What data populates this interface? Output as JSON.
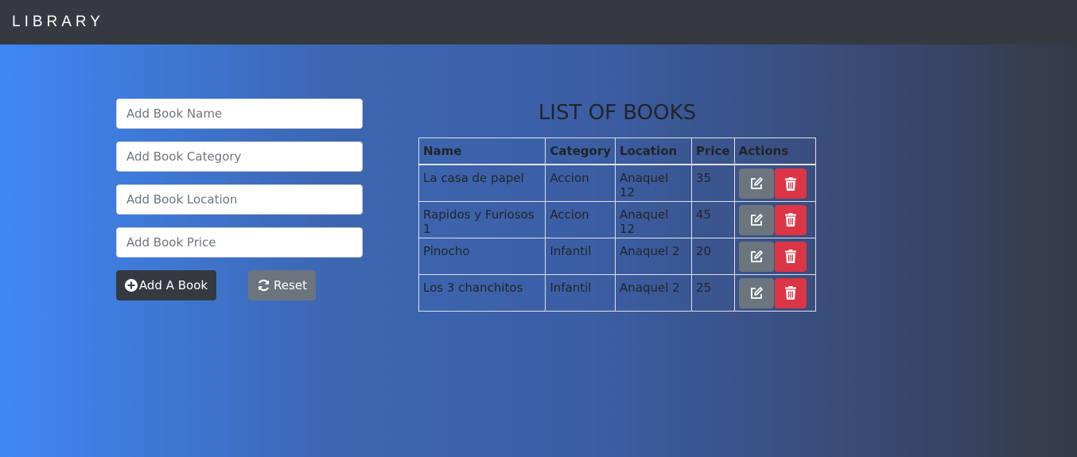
{
  "navbar": {
    "brand": "LIBRARY"
  },
  "form": {
    "name_placeholder": "Add Book Name",
    "category_placeholder": "Add Book Category",
    "location_placeholder": "Add Book Location",
    "price_placeholder": "Add Book Price",
    "add_button": {
      "label": "Add A Book",
      "icon": "plus-circle-icon"
    },
    "reset_button": {
      "label": "Reset",
      "icon": "refresh-icon"
    }
  },
  "list": {
    "title": "LIST OF BOOKS",
    "headers": [
      "Name",
      "Category",
      "Location",
      "Price",
      "Actions"
    ],
    "rows": [
      {
        "name": "La casa de papel",
        "category": "Accion",
        "location": "Anaquel 12",
        "price": "35"
      },
      {
        "name": "Rapidos y Furiosos 1",
        "category": "Accion",
        "location": "Anaquel 12",
        "price": "45"
      },
      {
        "name": "Pinocho",
        "category": "Infantil",
        "location": "Anaquel 2",
        "price": "20"
      },
      {
        "name": "Los 3 chanchitos",
        "category": "Infantil",
        "location": "Anaquel 2",
        "price": "25"
      }
    ],
    "edit_icon": "edit-icon",
    "delete_icon": "trash-icon"
  },
  "colors": {
    "navbar": "#343a40",
    "edit_button": "#6c757d",
    "delete_button": "#dc3545",
    "gradient_start": "#3f88f5",
    "gradient_end": "#343a46"
  }
}
